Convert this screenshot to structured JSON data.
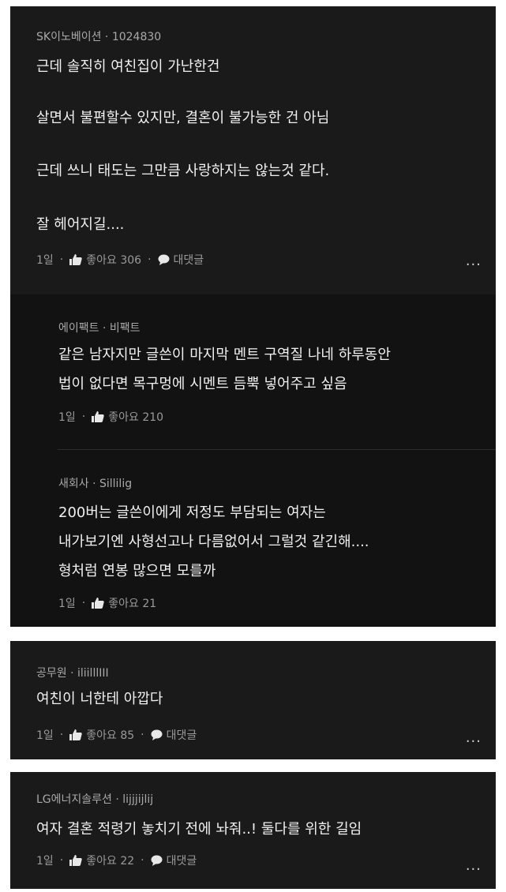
{
  "comments": [
    {
      "author": "SK이노베이션 · 1024830",
      "lines": [
        "근데 솔직히 여친집이 가난한건",
        "살면서 불편할수 있지만, 결혼이 불가능한 건 아님",
        "근데 쓰니 태도는 그만큼 사랑하지는 않는것 같다.",
        "잘 헤어지길...."
      ],
      "time": "1일",
      "likes": "좋아요 306",
      "reply": "대댓글",
      "more": "...",
      "replies": [
        {
          "author": "에이팩트 · 비팩트",
          "lines": [
            "같은 남자지만 글쓴이 마지막 멘트 구역질 나네 하루동안",
            "법이 없다면 목구멍에 시멘트 듬뿍 넣어주고 싶음"
          ],
          "time": "1일",
          "likes": "좋아요 210"
        },
        {
          "author": "새회사 · Sillilig",
          "lines": [
            "200버는 글쓴이에게 저정도 부담되는 여자는",
            "내가보기엔 사형선고나 다름없어서 그럴것 같긴해....",
            "형처럼 연봉 많으면 모를까"
          ],
          "time": "1일",
          "likes": "좋아요 21"
        }
      ]
    },
    {
      "author": "공무원 · iliilllIII",
      "lines": [
        "여친이 너한테 아깝다"
      ],
      "time": "1일",
      "likes": "좋아요 85",
      "reply": "대댓글",
      "more": "..."
    },
    {
      "author": "LG에너지솔루션 · lijjjijlij",
      "lines": [
        "여자 결혼 적령기 놓치기 전에 놔줘..! 둘다를 위한 길임"
      ],
      "time": "1일",
      "likes": "좋아요 22",
      "reply": "대댓글",
      "more": "..."
    }
  ],
  "separator": "·",
  "icons": {
    "like": "thumbs-up-icon",
    "reply": "speech-bubble-icon"
  },
  "colors": {
    "card_bg": "#1a1a1a",
    "reply_bg": "#121212",
    "text": "#f0f0f0",
    "meta": "#a9a9a9"
  }
}
